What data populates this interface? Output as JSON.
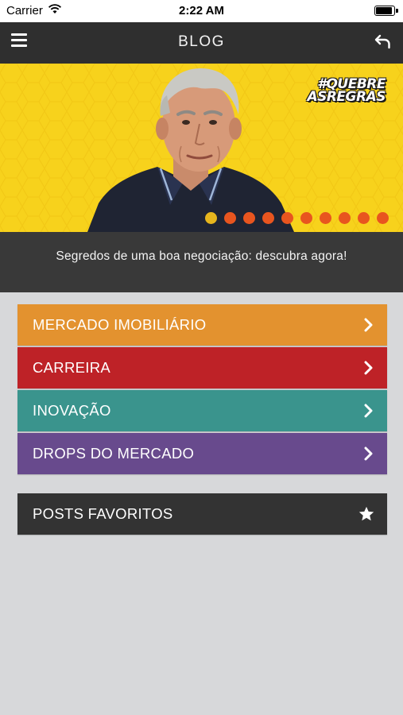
{
  "status_bar": {
    "carrier": "Carrier",
    "time": "2:22 AM"
  },
  "nav": {
    "title": "BLOG",
    "menu_icon": "hamburger-menu-icon",
    "back_icon": "undo-arrow-icon"
  },
  "hero": {
    "hashtag_line1": "#QUEBRE",
    "hashtag_line2": "ASREGRAS",
    "slide_count": 10,
    "active_slide": 1,
    "background_color": "#f7d21c",
    "dot_color": "#e8551f",
    "active_dot_color": "#e6b51d"
  },
  "caption": "Segredos de uma boa negociação: descubra agora!",
  "categories": [
    {
      "label": "MERCADO IMOBILIÁRIO",
      "color": "#e3922f"
    },
    {
      "label": "CARREIRA",
      "color": "#be2227"
    },
    {
      "label": "INOVAÇÃO",
      "color": "#3a948d"
    },
    {
      "label": "DROPS DO MERCADO",
      "color": "#684a8d"
    }
  ],
  "favorites": {
    "label": "POSTS FAVORITOS",
    "icon": "star-icon",
    "color": "#333333"
  }
}
